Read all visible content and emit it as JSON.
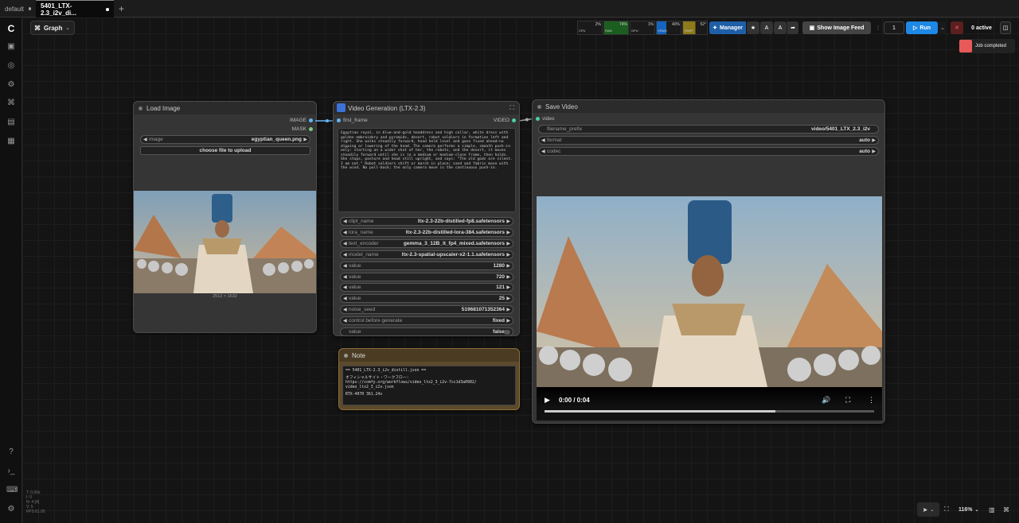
{
  "tabs": [
    {
      "label": "default"
    },
    {
      "label": "5401_LTX-2.3_i2v_di..."
    }
  ],
  "graph_label": "Graph",
  "monitor": {
    "cpu": "2%",
    "cpu_label": "CPU",
    "ram": "74%",
    "ram_label": "RAM",
    "gpu": "1%",
    "gpu_label": "GPU",
    "vram": "40%",
    "vram_label": "VRAM",
    "temp": "52°",
    "temp_label": "TEMP"
  },
  "toolbar": {
    "manager": "Manager",
    "show_image_feed": "Show Image Feed",
    "queue_count": "1",
    "run": "Run",
    "active": "0 active"
  },
  "toast": {
    "text": "Job completed"
  },
  "load_image": {
    "title": "Load Image",
    "out_image": "IMAGE",
    "out_mask": "MASK",
    "image_label": "image",
    "image_value": "egyptian_queen.png",
    "upload": "choose file to upload",
    "dims": "2512 × 1632"
  },
  "video_gen": {
    "title": "Video Generation (LTX-2.3)",
    "in_first_frame": "first_frame",
    "out_video": "VIDEO",
    "prompt": "Egyptian royal, in blue-and-gold headdress and high collar, white dress with golden embroidery and pyramids, desert, robot soldiers in formation left and right. She walks steadily forward, head held level and gaze fixed ahead—no dipping or lowering of the head. The camera performs a simple, smooth push-in only: starting on a wider shot of her, the robots, and the desert, it moves steadily forward until she is in a medium or medium-close frame, then holds. She stops, posture and head still upright, and says: \"The old gods are silent. I am not.\" Robot soldiers shift or march in place; sand and fabric move with the wind. No pull-back; the only camera move is the continuous push-in.",
    "widgets": [
      {
        "name": "clipt_name",
        "value": "ltx-2.3-22b-distilled-fp8.safetensors"
      },
      {
        "name": "lora_name",
        "value": "ltx-2.3-22b-distilled-lora-384.safetensors"
      },
      {
        "name": "text_encoder",
        "value": "gemma_3_12B_it_fp4_mixed.safetensors"
      },
      {
        "name": "model_name",
        "value": "ltx-2.3-spatial-upscaler-x2-1.1.safetensors"
      },
      {
        "name": "value",
        "value": "1280"
      },
      {
        "name": "value",
        "value": "720"
      },
      {
        "name": "value",
        "value": "121"
      },
      {
        "name": "value",
        "value": "25"
      },
      {
        "name": "noise_seed",
        "value": "519681071352364"
      },
      {
        "name": "control before generate",
        "value": "fixed"
      },
      {
        "name": "value",
        "value": "false"
      }
    ]
  },
  "note": {
    "title": "Note",
    "line1": "== 5401_LTX-2.3_i2v_distill.json ==",
    "line2": "オフィシャルサイト・ワークフロー:",
    "line3": "https://comfy.org/workflows/video_ltx2_3_i2v-7cc1d3a0982/",
    "line4": "video_ltx2_3_i2v.json",
    "line5": "RTX-4070     361.24s"
  },
  "save_video": {
    "title": "Save Video",
    "in_video": "video",
    "widgets": [
      {
        "name": "filename_prefix",
        "value": "video/5401_LTX_2.3_i2v"
      },
      {
        "name": "format",
        "value": "auto"
      },
      {
        "name": "codec",
        "value": "auto"
      }
    ],
    "time": "0:00 / 0:04",
    "progress": 0.7
  },
  "stats": {
    "l1": "T: 0.00s",
    "l2": "I: 0",
    "l3": "N: 4 [4]",
    "l4": "V: 5",
    "l5": "FPS:61.05"
  },
  "zoom": "116%"
}
